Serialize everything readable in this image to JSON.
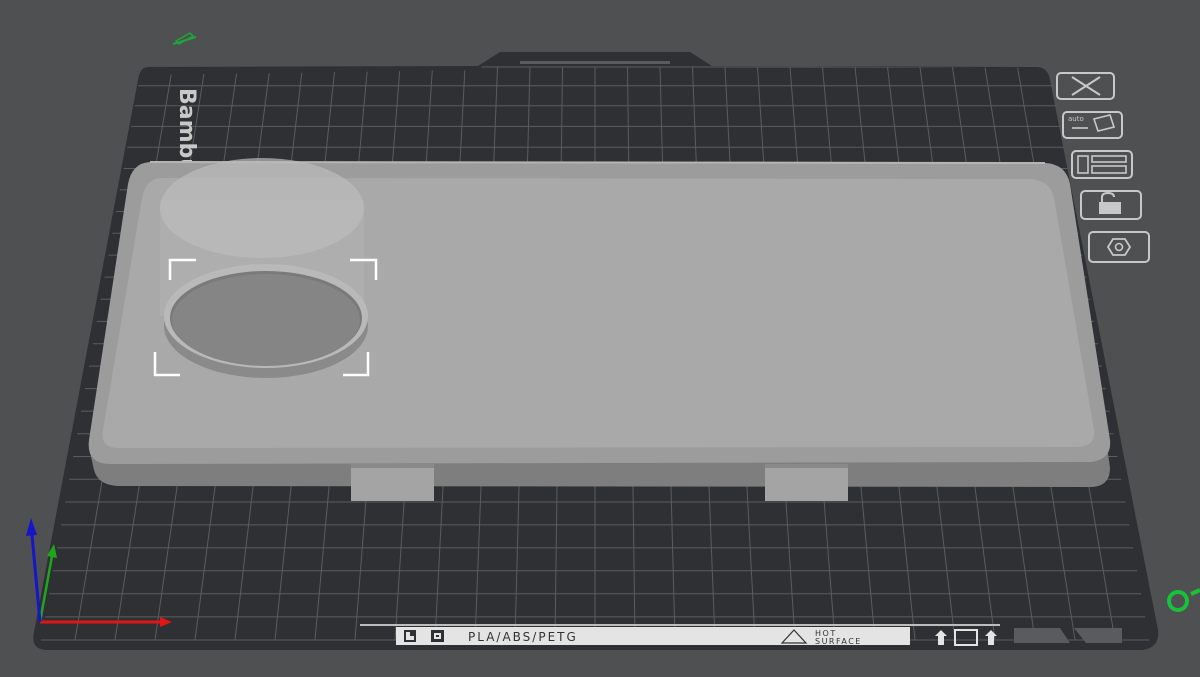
{
  "plate": {
    "brand_text": "Bambu T",
    "filament_label": "PLA/ABS/PETG",
    "warning_line1": "HOT",
    "warning_line2": "SURFACE"
  },
  "plate_toolbar": {
    "items": [
      {
        "name": "close-plate-icon"
      },
      {
        "name": "auto-orient-icon",
        "label": "auto"
      },
      {
        "name": "arrange-icon"
      },
      {
        "name": "lock-icon"
      },
      {
        "name": "plate-settings-icon"
      }
    ]
  },
  "colors": {
    "background": "#4f5052",
    "plate": "#2f3033",
    "grid": "#5b5c5f",
    "model": "#a7a7a7",
    "axis_x": "#e01616",
    "axis_y": "#1ea71e",
    "axis_z": "#1616c8"
  }
}
